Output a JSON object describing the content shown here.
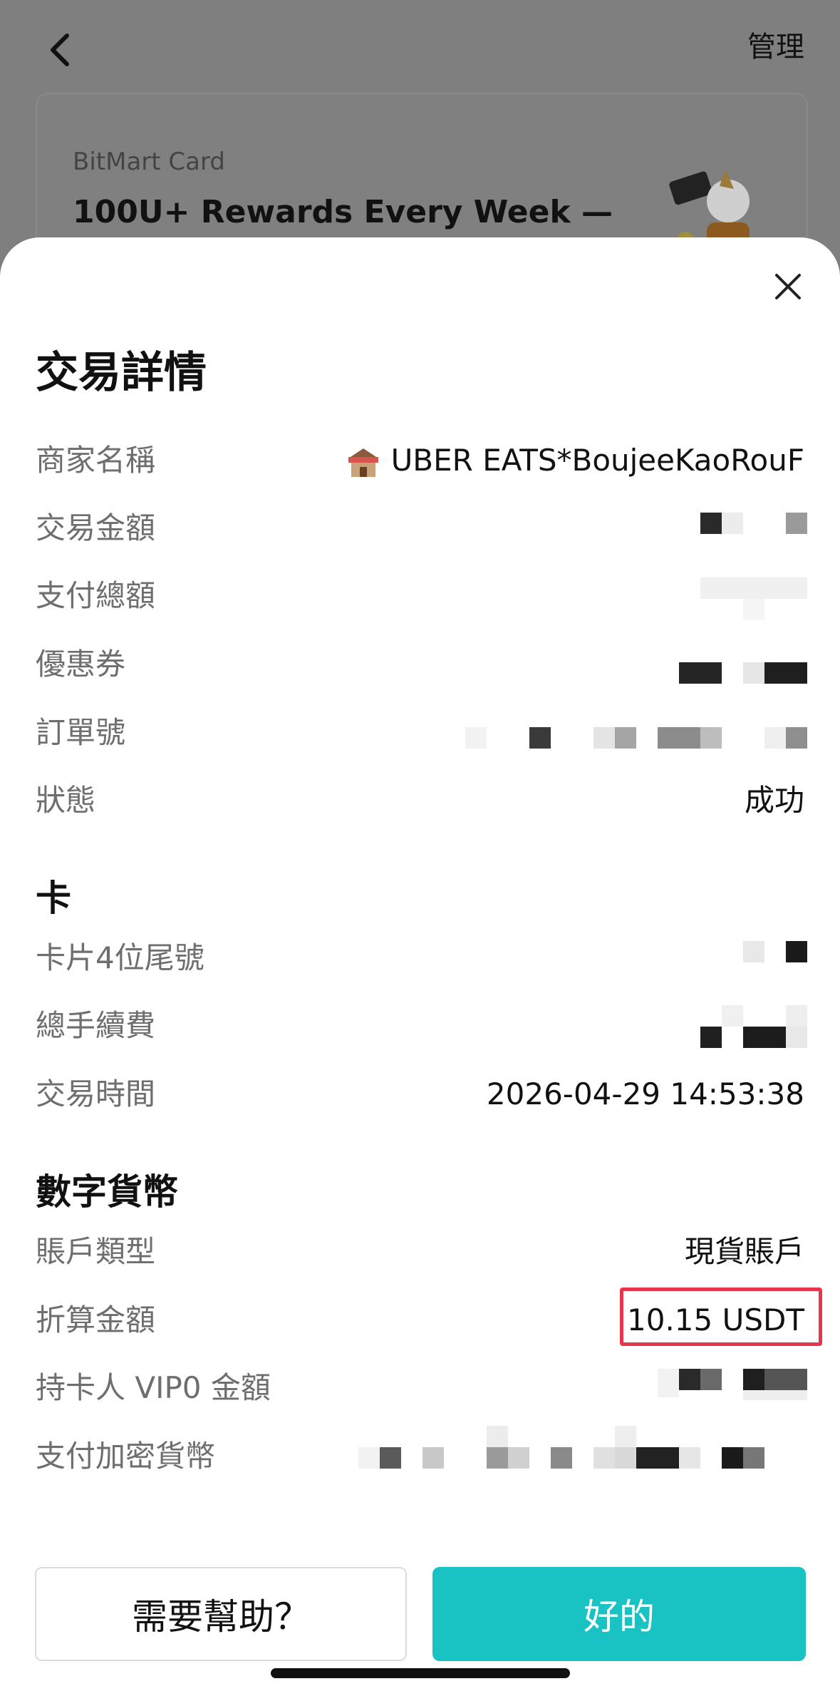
{
  "header": {
    "manage_label": "管理"
  },
  "promo": {
    "subtitle": "BitMart Card",
    "title": "100U+ Rewards Every Week —"
  },
  "sheet": {
    "title": "交易詳情"
  },
  "details": {
    "merchant_label": "商家名稱",
    "merchant_value": "UBER EATS*BoujeeKaoRouF",
    "amount_label": "交易金額",
    "total_label": "支付總額",
    "coupon_label": "優惠券",
    "order_label": "訂單號",
    "status_label": "狀態",
    "status_value": "成功"
  },
  "card": {
    "section_title": "卡",
    "last4_label": "卡片4位尾號",
    "fee_label": "總手續費",
    "time_label": "交易時間",
    "time_value": "2026-04-29 14:53:38"
  },
  "crypto": {
    "section_title": "數字貨幣",
    "account_type_label": "賬戶類型",
    "account_type_value": "現貨賬戶",
    "converted_label": "折算金額",
    "converted_value": "10.15 USDT",
    "vip_label": "持卡人 VIP0 金額",
    "pay_crypto_label": "支付加密貨幣"
  },
  "buttons": {
    "help_label": "需要幫助？",
    "ok_label": "好的"
  },
  "colors": {
    "accent": "#19c3c3",
    "highlight": "#e6364b"
  }
}
